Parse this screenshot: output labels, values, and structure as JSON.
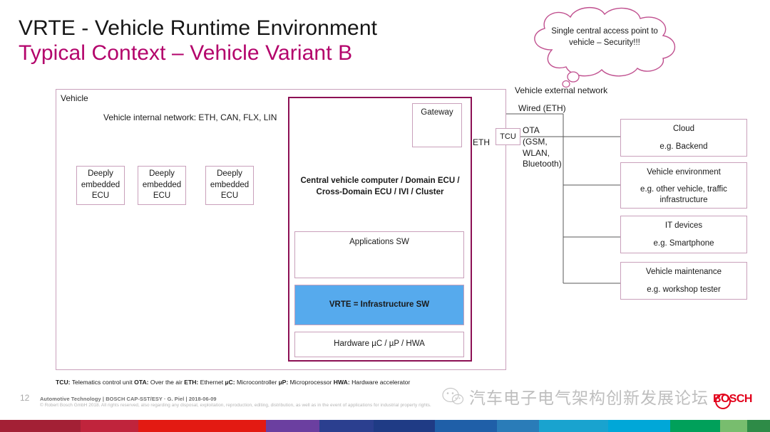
{
  "title": {
    "line1": "VRTE - Vehicle Runtime Environment",
    "line2": "Typical Context – Vehicle Variant B",
    "accent_color": "#b3036b"
  },
  "callout": {
    "text": "Single central access point to vehicle – Security!!!",
    "outline_color": "#c0508f"
  },
  "labels": {
    "vehicle_external_network": "Vehicle external network",
    "vehicle": "Vehicle",
    "internal_network": "Vehicle internal network: ETH, CAN, FLX, LIN",
    "eth": "ETH",
    "wired_eth": "Wired (ETH)",
    "ota": "OTA (GSM, WLAN, Bluetooth)"
  },
  "ecus": [
    {
      "name": "Deeply embedded ECU"
    },
    {
      "name": "Deeply embedded ECU"
    },
    {
      "name": "Deeply embedded ECU"
    }
  ],
  "central_computer": {
    "title": "Central vehicle computer / Domain ECU / Cross-Domain ECU / IVI / Cluster",
    "border_color": "#8c1054",
    "gateway": "Gateway",
    "stack": {
      "applications": "Applications SW",
      "vrte": "VRTE = Infrastructure SW",
      "vrte_color": "#56aaed",
      "hardware": "Hardware µC / µP / HWA"
    }
  },
  "tcu": {
    "label": "TCU"
  },
  "external_systems": [
    {
      "title": "Cloud",
      "example": "e.g. Backend"
    },
    {
      "title": "Vehicle environment",
      "example": "e.g. other vehicle, traffic infrastructure"
    },
    {
      "title": "IT devices",
      "example": "e.g. Smartphone"
    },
    {
      "title": "Vehicle maintenance",
      "example": "e.g. workshop tester"
    }
  ],
  "legend": {
    "items": [
      {
        "abbr": "TCU:",
        "text": " Telematics control unit "
      },
      {
        "abbr": "OTA:",
        "text": " Over the air "
      },
      {
        "abbr": "ETH:",
        "text": " Ethernet "
      },
      {
        "abbr": "µC:",
        "text": " Microcontroller "
      },
      {
        "abbr": "µP:",
        "text": " Microprocessor "
      },
      {
        "abbr": "HWA:",
        "text": " Hardware accelerator"
      }
    ]
  },
  "footer": {
    "page_number": "12",
    "line1": "Automotive Technology | BOSCH CAP-SST/ESY · G. Piel | 2018-06-09",
    "line2": "© Robert Bosch GmbH 2018. All rights reserved, also regarding any disposal, exploitation, reproduction, editing, distribution, as well as in the event of applications for industrial property rights.",
    "brand": "BOSCH"
  },
  "watermark": {
    "text": "汽车电子电气架构创新发展论坛"
  },
  "color_bar": {
    "segments": [
      {
        "color": "#a32035",
        "width": 10.5
      },
      {
        "color": "#c0243c",
        "width": 7.5
      },
      {
        "color": "#e31a12",
        "width": 16.5
      },
      {
        "color": "#6b3fa0",
        "width": 7.0
      },
      {
        "color": "#2b3f8f",
        "width": 7.0
      },
      {
        "color": "#1f3b85",
        "width": 8.0
      },
      {
        "color": "#1f5fa8",
        "width": 8.0
      },
      {
        "color": "#2a7cb8",
        "width": 5.5
      },
      {
        "color": "#19a3cf",
        "width": 9.0
      },
      {
        "color": "#00a7d8",
        "width": 8.0
      },
      {
        "color": "#00a05a",
        "width": 6.5
      },
      {
        "color": "#78bd6e",
        "width": 3.5
      },
      {
        "color": "#2e8b47",
        "width": 3.0
      }
    ]
  }
}
